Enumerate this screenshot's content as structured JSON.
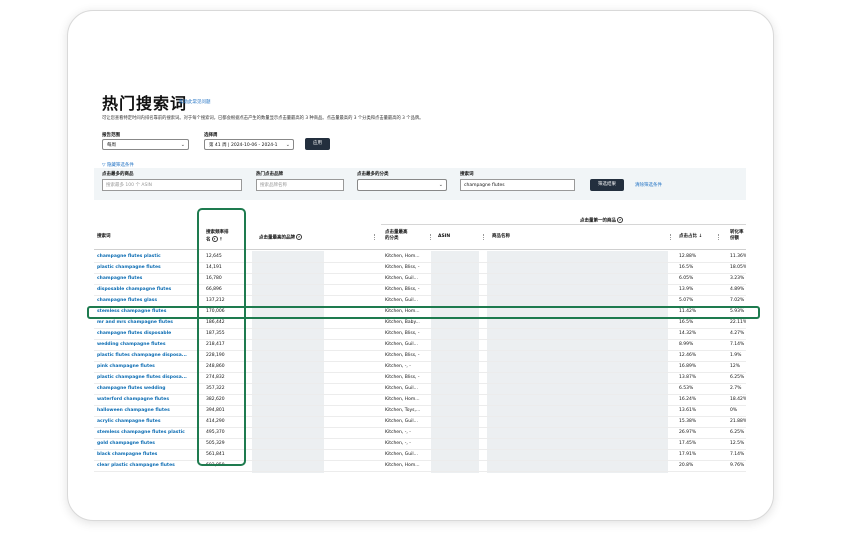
{
  "header": {
    "title": "热门搜索词",
    "help_link": "帮助此常见问题",
    "description": "可让您查看特定时间内排名靠前的搜索词。对于每个搜索词，已都会根据点击产生的数量显示点击量最高的 3 种商品。点击量最高的 3 个分类和点击量最高的 3 个品牌。"
  },
  "filters": {
    "report_range_label": "报告范围",
    "report_range_value": "每周",
    "week_label": "选择周",
    "week_value": "第 41 周 | 2024-10-06 - 2024-1",
    "apply_label": "应用",
    "toggle_label": "隐藏筛选条件",
    "product_label": "点击最多的商品",
    "product_placeholder": "搜索最多 100 个 ASIN",
    "brand_label": "热门点击品牌",
    "brand_placeholder": "搜索品牌名称",
    "category_label": "点击最多的分类",
    "category_value": "",
    "keyword_label": "搜索词",
    "keyword_value": "champagne flutes",
    "filter_button": "筛选结果",
    "clear_label": "清除筛选条件"
  },
  "table": {
    "group_header": "点击量第一的商品",
    "columns": {
      "keyword": "搜索词",
      "rank": "搜索频率排名",
      "brand": "点击量最高的品牌",
      "category": "点击量最高的分类",
      "asin": "ASIN",
      "product_name": "商品名称",
      "click_share": "点击占比",
      "conversion": "转化率份额"
    },
    "rows": [
      {
        "keyword": "champagne flutes plastic",
        "rank": "12,645",
        "category": "Kitchen, Hom...",
        "click": "12.88%",
        "conv": "11.36%"
      },
      {
        "keyword": "plastic champagne flutes",
        "rank": "14,191",
        "category": "Kitchen, Bliss, -",
        "click": "16.5%",
        "conv": "18.05%"
      },
      {
        "keyword": "champagne flutes",
        "rank": "16,780",
        "category": "Kitchen, Guil...",
        "click": "6.05%",
        "conv": "3.23%"
      },
      {
        "keyword": "disposable champagne flutes",
        "rank": "66,896",
        "category": "Kitchen, Bliss, -",
        "click": "13.9%",
        "conv": "4.89%"
      },
      {
        "keyword": "champagne flutes glass",
        "rank": "137,212",
        "category": "Kitchen, Guil...",
        "click": "5.07%",
        "conv": "7.02%"
      },
      {
        "keyword": "stemless champagne flutes",
        "rank": "170,006",
        "category": "Kitchen, Hom...",
        "click": "11.42%",
        "conv": "5.93%"
      },
      {
        "keyword": "mr and mrs champagne flutes",
        "rank": "186,442",
        "category": "Kitchen, Baby...",
        "click": "16.5%",
        "conv": "22.11%"
      },
      {
        "keyword": "champagne flutes disposable",
        "rank": "187,355",
        "category": "Kitchen, Bliss, -",
        "click": "14.32%",
        "conv": "4.27%"
      },
      {
        "keyword": "wedding champagne flutes",
        "rank": "218,417",
        "category": "Kitchen, Guil...",
        "click": "8.99%",
        "conv": "7.14%"
      },
      {
        "keyword": "plastic flutes champagne disposa...",
        "rank": "228,190",
        "category": "Kitchen, Bliss, -",
        "click": "12.46%",
        "conv": "1.9%"
      },
      {
        "keyword": "pink champagne flutes",
        "rank": "248,860",
        "category": "Kitchen, -, -",
        "click": "16.89%",
        "conv": "12%"
      },
      {
        "keyword": "plastic champagne flutes disposa...",
        "rank": "274,832",
        "category": "Kitchen, Bliss, -",
        "click": "13.87%",
        "conv": "6.25%"
      },
      {
        "keyword": "champagne flutes wedding",
        "rank": "357,322",
        "category": "Kitchen, Guil...",
        "click": "6.53%",
        "conv": "2.7%"
      },
      {
        "keyword": "waterford champagne flutes",
        "rank": "382,620",
        "category": "Kitchen, Hom...",
        "click": "16.24%",
        "conv": "18.42%"
      },
      {
        "keyword": "halloween champagne flutes",
        "rank": "394,801",
        "category": "Kitchen, Toys,...",
        "click": "13.61%",
        "conv": "0%"
      },
      {
        "keyword": "acrylic champagne flutes",
        "rank": "414,290",
        "category": "Kitchen, Guil...",
        "click": "15.38%",
        "conv": "21.88%"
      },
      {
        "keyword": "stemless champagne flutes plastic",
        "rank": "495,370",
        "category": "Kitchen, -, -",
        "click": "26.97%",
        "conv": "6.25%"
      },
      {
        "keyword": "gold champagne flutes",
        "rank": "505,329",
        "category": "Kitchen, -, -",
        "click": "17.45%",
        "conv": "12.5%"
      },
      {
        "keyword": "black champagne flutes",
        "rank": "561,841",
        "category": "Kitchen, Guil...",
        "click": "17.91%",
        "conv": "7.14%"
      },
      {
        "keyword": "clear plastic champagne flutes",
        "rank": "602,059",
        "category": "Kitchen, Hom...",
        "click": "20.8%",
        "conv": "9.76%"
      }
    ]
  },
  "colors": {
    "link": "#0d6db3",
    "highlight": "#1e7b4f",
    "button": "#232f3e"
  }
}
